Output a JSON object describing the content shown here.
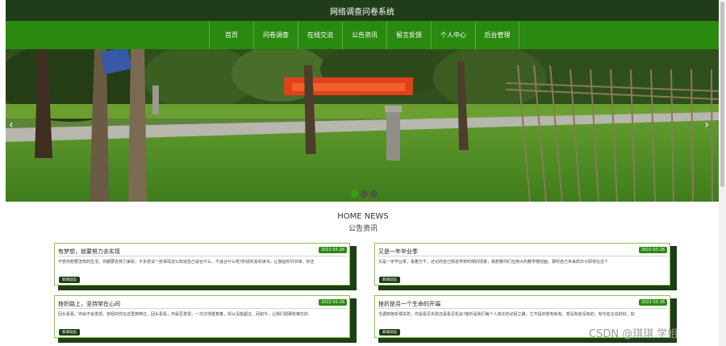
{
  "app_title": "网络调查问卷系统",
  "nav": {
    "items": [
      "首页",
      "问卷调查",
      "在线交流",
      "公告资讯",
      "留言反馈",
      "个人中心",
      "后台管理"
    ]
  },
  "banner": {
    "prev_label": "‹",
    "next_label": "›",
    "slide_count": 3,
    "active_slide": 1
  },
  "news": {
    "heading_en": "HOME NEWS",
    "heading_cn": "公告资讯",
    "cards": [
      {
        "title": "有梦想，就要努力去实现",
        "date": "2022-03-26",
        "desc": "不管你想要怎样的生活，你都要去努力争取，不多尝试一些事情怎么知道自己适合什么、不适合什么呢?你说你喜欢读书，让我给你列书单，你还",
        "tag": "新闻动态"
      },
      {
        "title": "又是一年毕业季",
        "date": "2022-03-26",
        "desc": "又是一年毕业季，看着万千，还记的自己刚进学校时候的情景，我想着你们在南大的教学楼前面，那时自己未来的日子即将在这个",
        "tag": "新闻动态"
      },
      {
        "title": "挫折路上，坚持常在心间",
        "date": "2022-03-26",
        "desc": "回头看看，你会不会发现，曾经的你在这里摔倒过，回头看看，你是否发现，一次次地重复着，却从没能超过，而如今，让我们把那些难忘的",
        "tag": "新闻动态"
      },
      {
        "title": "挫折是另一个生命的开端",
        "date": "2022-03-26",
        "desc": "当遇到挫折或失败，你是看见失败还是看见机会?挫折是我们每个人成长的必经之路，它不是你想有就有，想没有就没有的，有句名言说的好，如",
        "tag": "新闻动态"
      }
    ]
  },
  "watermark": "CSDN @琪琪 学姐",
  "colors": {
    "topbar": "#1f3d18",
    "nav": "#2a8a10",
    "accent": "#2a8a10",
    "card_border": "#8bc34a"
  }
}
